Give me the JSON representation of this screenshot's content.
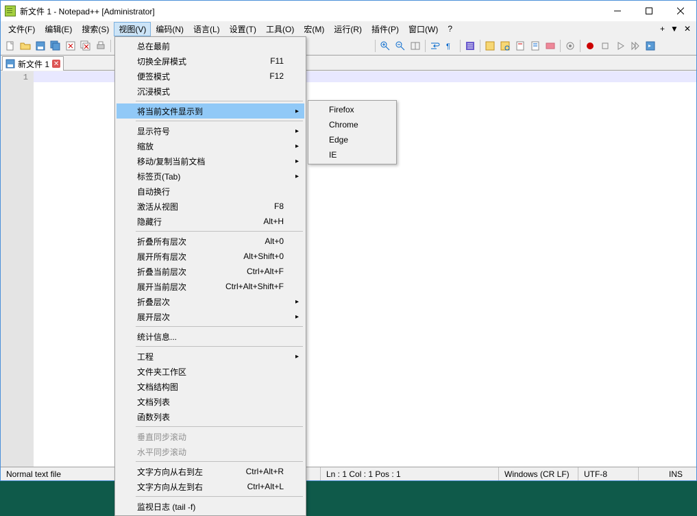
{
  "title": "新文件 1 - Notepad++ [Administrator]",
  "menubar": {
    "file": "文件(F)",
    "edit": "编辑(E)",
    "search": "搜索(S)",
    "view": "视图(V)",
    "encoding": "编码(N)",
    "language": "语言(L)",
    "settings": "设置(T)",
    "tools": "工具(O)",
    "macro": "宏(M)",
    "run": "运行(R)",
    "plugins": "插件(P)",
    "window": "窗口(W)",
    "help": "?"
  },
  "menu_extra": {
    "plus": "+",
    "down": "▼",
    "x": "✕"
  },
  "tab": {
    "label": "新文件 1"
  },
  "line_number": "1",
  "status": {
    "filetype": "Normal text file",
    "pos": "Ln : 1    Col : 1    Pos : 1",
    "eol": "Windows (CR LF)",
    "enc": "UTF-8",
    "ins": "INS"
  },
  "view_menu": [
    {
      "type": "item",
      "label": "总在最前"
    },
    {
      "type": "item",
      "label": "切换全屏模式",
      "shortcut": "F11"
    },
    {
      "type": "item",
      "label": "便签模式",
      "shortcut": "F12"
    },
    {
      "type": "item",
      "label": "沉浸模式"
    },
    {
      "type": "sep"
    },
    {
      "type": "item",
      "label": "将当前文件显示到",
      "submenu": true,
      "highlighted": true
    },
    {
      "type": "sep"
    },
    {
      "type": "item",
      "label": "显示符号",
      "submenu": true
    },
    {
      "type": "item",
      "label": "缩放",
      "submenu": true
    },
    {
      "type": "item",
      "label": "移动/复制当前文档",
      "submenu": true
    },
    {
      "type": "item",
      "label": "标签页(Tab)",
      "submenu": true
    },
    {
      "type": "item",
      "label": "自动换行"
    },
    {
      "type": "item",
      "label": "激活从视图",
      "shortcut": "F8"
    },
    {
      "type": "item",
      "label": "隐藏行",
      "shortcut": "Alt+H"
    },
    {
      "type": "sep"
    },
    {
      "type": "item",
      "label": "折叠所有层次",
      "shortcut": "Alt+0"
    },
    {
      "type": "item",
      "label": "展开所有层次",
      "shortcut": "Alt+Shift+0"
    },
    {
      "type": "item",
      "label": "折叠当前层次",
      "shortcut": "Ctrl+Alt+F"
    },
    {
      "type": "item",
      "label": "展开当前层次",
      "shortcut": "Ctrl+Alt+Shift+F"
    },
    {
      "type": "item",
      "label": "折叠层次",
      "submenu": true
    },
    {
      "type": "item",
      "label": "展开层次",
      "submenu": true
    },
    {
      "type": "sep"
    },
    {
      "type": "item",
      "label": "统计信息..."
    },
    {
      "type": "sep"
    },
    {
      "type": "item",
      "label": "工程",
      "submenu": true
    },
    {
      "type": "item",
      "label": "文件夹工作区"
    },
    {
      "type": "item",
      "label": "文档结构图"
    },
    {
      "type": "item",
      "label": "文档列表"
    },
    {
      "type": "item",
      "label": "函数列表"
    },
    {
      "type": "sep"
    },
    {
      "type": "item",
      "label": "垂直同步滚动",
      "disabled": true
    },
    {
      "type": "item",
      "label": "水平同步滚动",
      "disabled": true
    },
    {
      "type": "sep"
    },
    {
      "type": "item",
      "label": "文字方向从右到左",
      "shortcut": "Ctrl+Alt+R"
    },
    {
      "type": "item",
      "label": "文字方向从左到右",
      "shortcut": "Ctrl+Alt+L"
    },
    {
      "type": "sep"
    },
    {
      "type": "item",
      "label": "监视日志 (tail -f)"
    }
  ],
  "submenu": [
    "Firefox",
    "Chrome",
    "Edge",
    "IE"
  ]
}
